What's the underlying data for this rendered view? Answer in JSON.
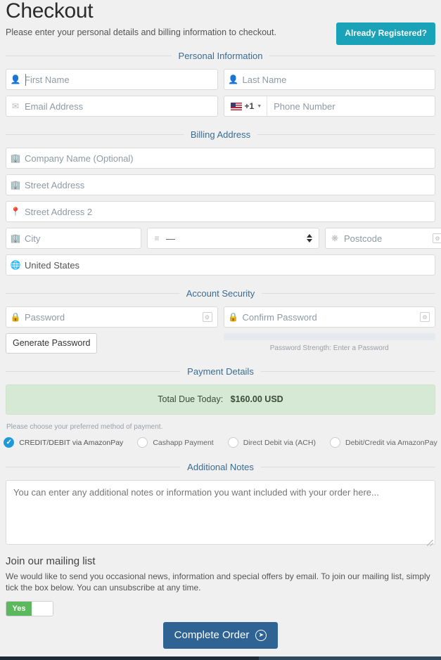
{
  "header": {
    "title": "Checkout",
    "subtitle": "Please enter your personal details and billing information to checkout.",
    "already_registered_label": "Already Registered?"
  },
  "sections": {
    "personal": "Personal Information",
    "billing": "Billing Address",
    "security": "Account Security",
    "payment": "Payment Details",
    "notes": "Additional Notes"
  },
  "personal": {
    "first_name_placeholder": "First Name",
    "first_name_value": "",
    "last_name_placeholder": "Last Name",
    "last_name_value": "",
    "email_placeholder": "Email Address",
    "email_value": "",
    "phone_prefix": "+1",
    "phone_placeholder": "Phone Number",
    "phone_value": ""
  },
  "billing": {
    "company_placeholder": "Company Name (Optional)",
    "company_value": "",
    "street_placeholder": "Street Address",
    "street_value": "",
    "street2_placeholder": "Street Address 2",
    "street2_value": "",
    "city_placeholder": "City",
    "city_value": "",
    "state_selected": "—",
    "postcode_placeholder": "Postcode",
    "postcode_value": "",
    "country_value": "United States"
  },
  "security": {
    "password_placeholder": "Password",
    "password_value": "",
    "confirm_placeholder": "Confirm Password",
    "confirm_value": "",
    "generate_label": "Generate Password",
    "strength_text": "Password Strength: Enter a Password"
  },
  "payment": {
    "total_label": "Total Due Today:",
    "total_amount": "$160.00 USD",
    "note": "Please choose your preferred method of payment.",
    "methods": [
      {
        "label": "CREDIT/DEBIT via AmazonPay",
        "selected": true
      },
      {
        "label": "Cashapp Payment",
        "selected": false
      },
      {
        "label": "Direct Debit via (ACH)",
        "selected": false
      },
      {
        "label": "Debit/Credit via AmazonPay",
        "selected": false
      }
    ]
  },
  "notes": {
    "placeholder": "You can enter any additional notes or information you want included with your order here...",
    "value": ""
  },
  "mailing": {
    "title": "Join our mailing list",
    "body": "We would like to send you occasional news, information and special offers by email. To join our mailing list, simply tick the box below. You can unsubscribe at any time.",
    "toggle_label": "Yes"
  },
  "submit": {
    "label": "Complete Order"
  },
  "colors": {
    "accent_teal": "#1aa3b8",
    "submit_blue": "#2e6393",
    "total_green_bg": "#d6e9d4",
    "radio_blue": "#1e9bd7",
    "toggle_green": "#5cb85c",
    "section_label": "#3a6b91"
  }
}
